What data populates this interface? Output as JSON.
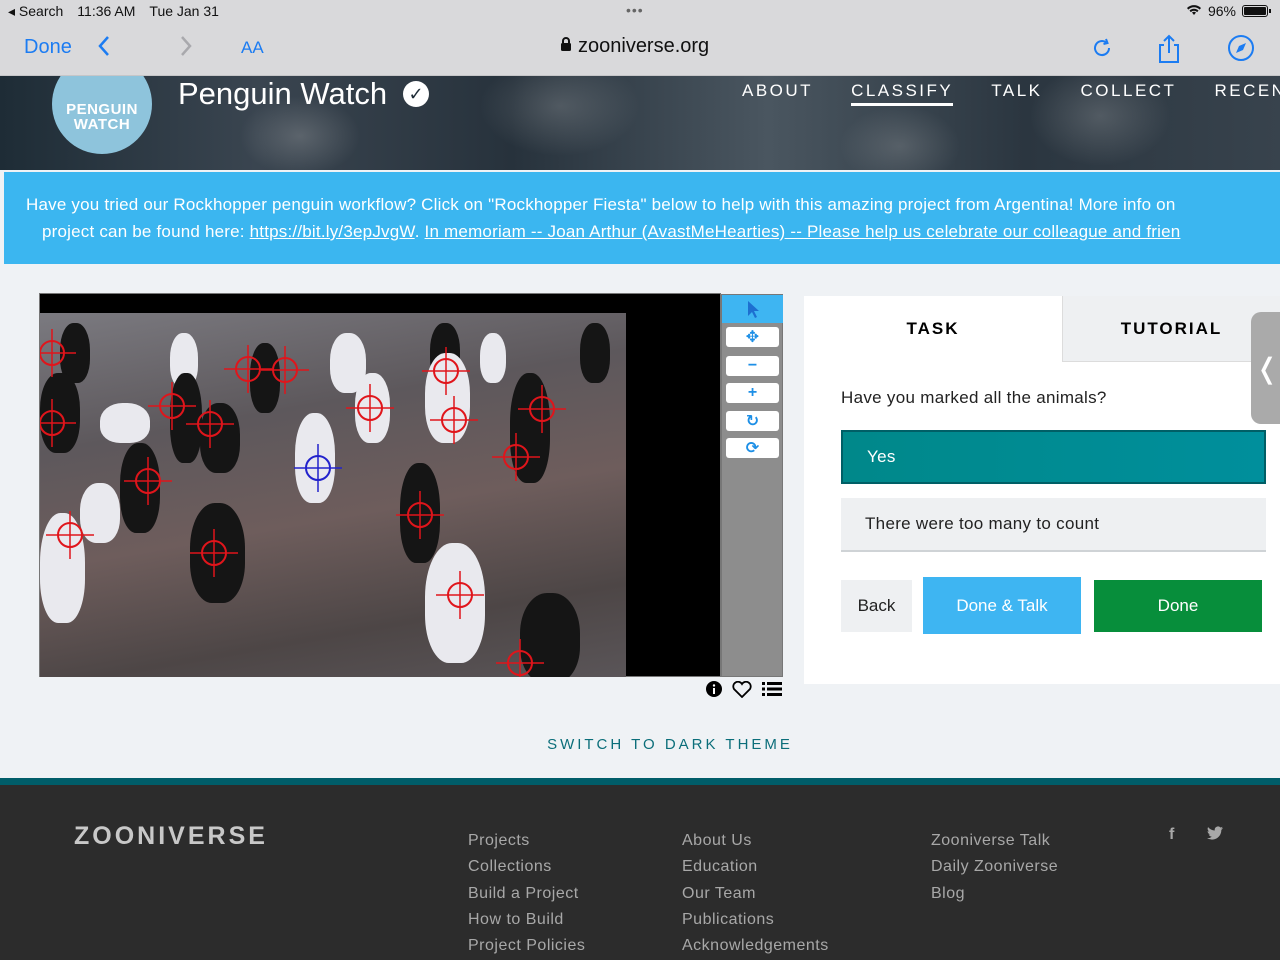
{
  "status": {
    "back_app": "Search",
    "time": "11:36 AM",
    "date": "Tue Jan 31",
    "battery": "96%"
  },
  "browser": {
    "done": "Done",
    "text_size": "AA",
    "url": "zooniverse.org"
  },
  "project": {
    "title": "Penguin Watch",
    "logo_text": "PENGUIN WATCH",
    "nav": [
      "ABOUT",
      "CLASSIFY",
      "TALK",
      "COLLECT",
      "RECENTS"
    ],
    "active_nav": "CLASSIFY"
  },
  "announcement": {
    "line1": "Have you tried our Rockhopper penguin workflow? Click on \"Rockhopper Fiesta\" below to help with this amazing project from Argentina! More info on",
    "line2_pre": "project can be found here: ",
    "link1": "https://bit.ly/3epJvgW",
    "sep": ". ",
    "link2": "In memoriam -- Joan Arthur (AvastMeHearties) -- Please help us celebrate our colleague and frien"
  },
  "task": {
    "tabs": [
      "TASK",
      "TUTORIAL"
    ],
    "question": "Have you marked all the animals?",
    "answers": [
      "Yes",
      "There were too many to count"
    ],
    "selected_answer": "Yes",
    "buttons": {
      "back": "Back",
      "done_talk": "Done & Talk",
      "done": "Done"
    }
  },
  "theme_toggle": "SWITCH TO DARK THEME",
  "footer": {
    "logo": "ZOONIVERSE",
    "col1": [
      "Projects",
      "Collections",
      "Build a Project",
      "How to Build",
      "Project Policies"
    ],
    "col2": [
      "About Us",
      "Education",
      "Our Team",
      "Publications",
      "Acknowledgements"
    ],
    "col3": [
      "Zooniverse Talk",
      "Daily Zooniverse",
      "Blog"
    ],
    "social": [
      "f",
      "t"
    ]
  },
  "colors": {
    "accent": "#3bb6f0",
    "selected": "#00888a",
    "done": "#078e3b",
    "marker": "#e0151b",
    "active_marker": "#2222cc"
  }
}
